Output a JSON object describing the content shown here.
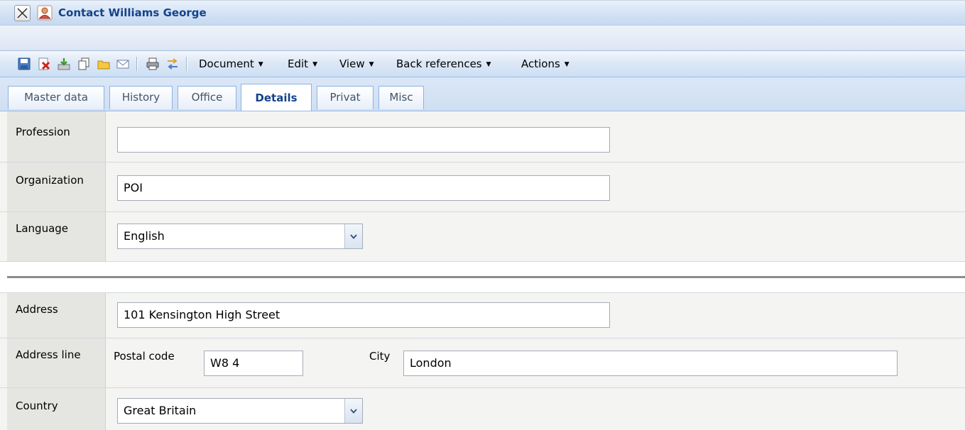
{
  "window": {
    "title": "Contact Williams George",
    "close_icon": "close-icon",
    "contact_icon": "contact-person-icon"
  },
  "toolbar": {
    "icons": [
      "save-icon",
      "delete-icon",
      "download-icon",
      "copy-icon",
      "folder-icon",
      "email-icon",
      "print-icon",
      "transfer-icon"
    ],
    "menus": {
      "document": "Document",
      "edit": "Edit",
      "view": "View",
      "back_references": "Back references",
      "actions": "Actions"
    }
  },
  "tabs": {
    "master_data": "Master data",
    "history": "History",
    "office": "Office",
    "details": "Details",
    "privat": "Privat",
    "misc": "Misc",
    "active": "Details"
  },
  "form": {
    "profession": {
      "label": "Profession",
      "value": ""
    },
    "organization": {
      "label": "Organization",
      "value": "POI"
    },
    "language": {
      "label": "Language",
      "value": "English"
    },
    "address": {
      "label": "Address",
      "value": "101 Kensington High Street"
    },
    "address_line": {
      "label": "Address line",
      "postal_code_label": "Postal code",
      "postal_code_value": "W8 4",
      "city_label": "City",
      "city_value": "London"
    },
    "country": {
      "label": "Country",
      "value": "Great Britain"
    }
  },
  "colors": {
    "title_text": "#15428b",
    "tab_border": "#8db2e3",
    "label_cell": "#e5e5e2"
  }
}
